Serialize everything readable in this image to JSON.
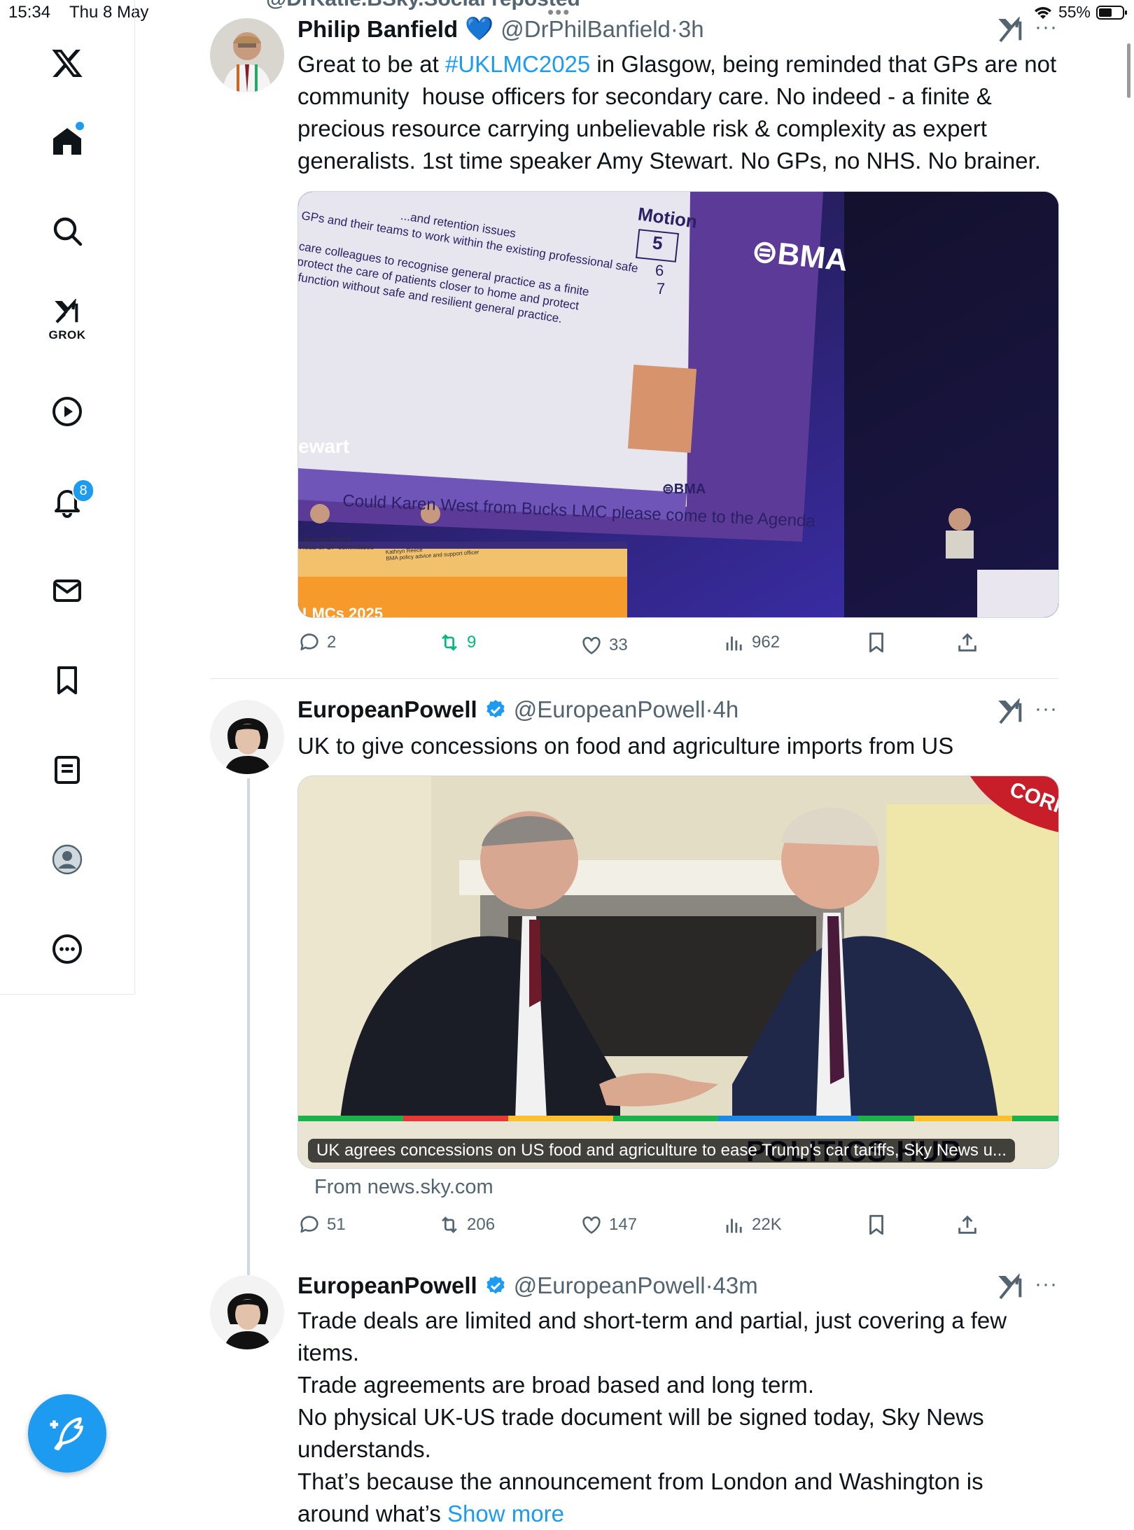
{
  "status_bar": {
    "time": "15:34",
    "date": "Thu 8 May",
    "battery": "55%",
    "battery_level": 0.55
  },
  "sidebar": {
    "items": [
      {
        "name": "x-logo-icon"
      },
      {
        "name": "home-icon",
        "has_dot": true
      },
      {
        "name": "search-icon"
      },
      {
        "name": "grok-icon",
        "label": "GROK"
      },
      {
        "name": "video-icon"
      },
      {
        "name": "notifications-icon",
        "badge": "8"
      },
      {
        "name": "messages-icon"
      },
      {
        "name": "bookmarks-icon"
      },
      {
        "name": "lists-icon"
      },
      {
        "name": "profile-icon"
      },
      {
        "name": "more-icon"
      }
    ]
  },
  "colors": {
    "accent": "#1d9bf0",
    "retweet_active": "#00ba7c",
    "secondary": "#536471"
  },
  "tweets": [
    {
      "name": "Philip Banfield",
      "emoji": "💙",
      "handle": "@DrPhilBanfield",
      "time": "·3h",
      "text_pre": "Great to be at ",
      "hashtag": "#UKLMC2025",
      "text_post": " in Glasgow, being reminded that GPs are not community  house officers for secondary care. No indeed - a finite & precious resource carrying unbelievable risk & complexity as expert generalists. 1st time speaker Amy Stewart. No GPs, no NHS. No brainer.",
      "media": {
        "slide_lines": [
          "...and retention issues",
          "GPs and their teams to work within the existing professional safe",
          "y care colleagues to recognise general practice as a finite",
          "o protect the care of patients closer to home and protect",
          "ot function without safe and resilient general practice."
        ],
        "motion_label": "Motion",
        "motion_numbers": [
          "5",
          "6",
          "7"
        ],
        "bma_logo": "BMA",
        "speaker": "ewart",
        "agenda_text": "Could Karen West from Bucks LMC please come to the Agenda",
        "nameplate_1": "Laurence Bunch\nHead of GP committees",
        "nameplate_2": "Kathryn Reece\nBMA policy advice and support officer",
        "banner_text": "LMCs 2025"
      },
      "replies": "2",
      "retweets": "9",
      "likes": "33",
      "views": "962",
      "retweeted_by_me": true
    },
    {
      "name": "EuropeanPowell",
      "handle": "@EuropeanPowell",
      "time": "·4h",
      "text": "UK to give concessions on food and agriculture imports from US",
      "card_caption": "UK agrees concessions on US food and agriculture to ease Trump's car tariffs, Sky News u...",
      "card_banner": "POLITICS HUB",
      "card_corner": "CORP",
      "card_source": "From news.sky.com",
      "replies": "51",
      "retweets": "206",
      "likes": "147",
      "views": "22K"
    },
    {
      "name": "EuropeanPowell",
      "handle": "@EuropeanPowell",
      "time": "·43m",
      "text": "Trade deals are limited and short-term and partial, just covering a few items.\nTrade agreements are broad based and long term.\nNo physical UK-US trade document will be signed today, Sky News understands.\nThat’s because the announcement from London and Washington is",
      "text_cut": "around what’s ",
      "show_more": "Show more"
    }
  ],
  "top_cut_label": "@DrKatie.BSky.Social reposted"
}
